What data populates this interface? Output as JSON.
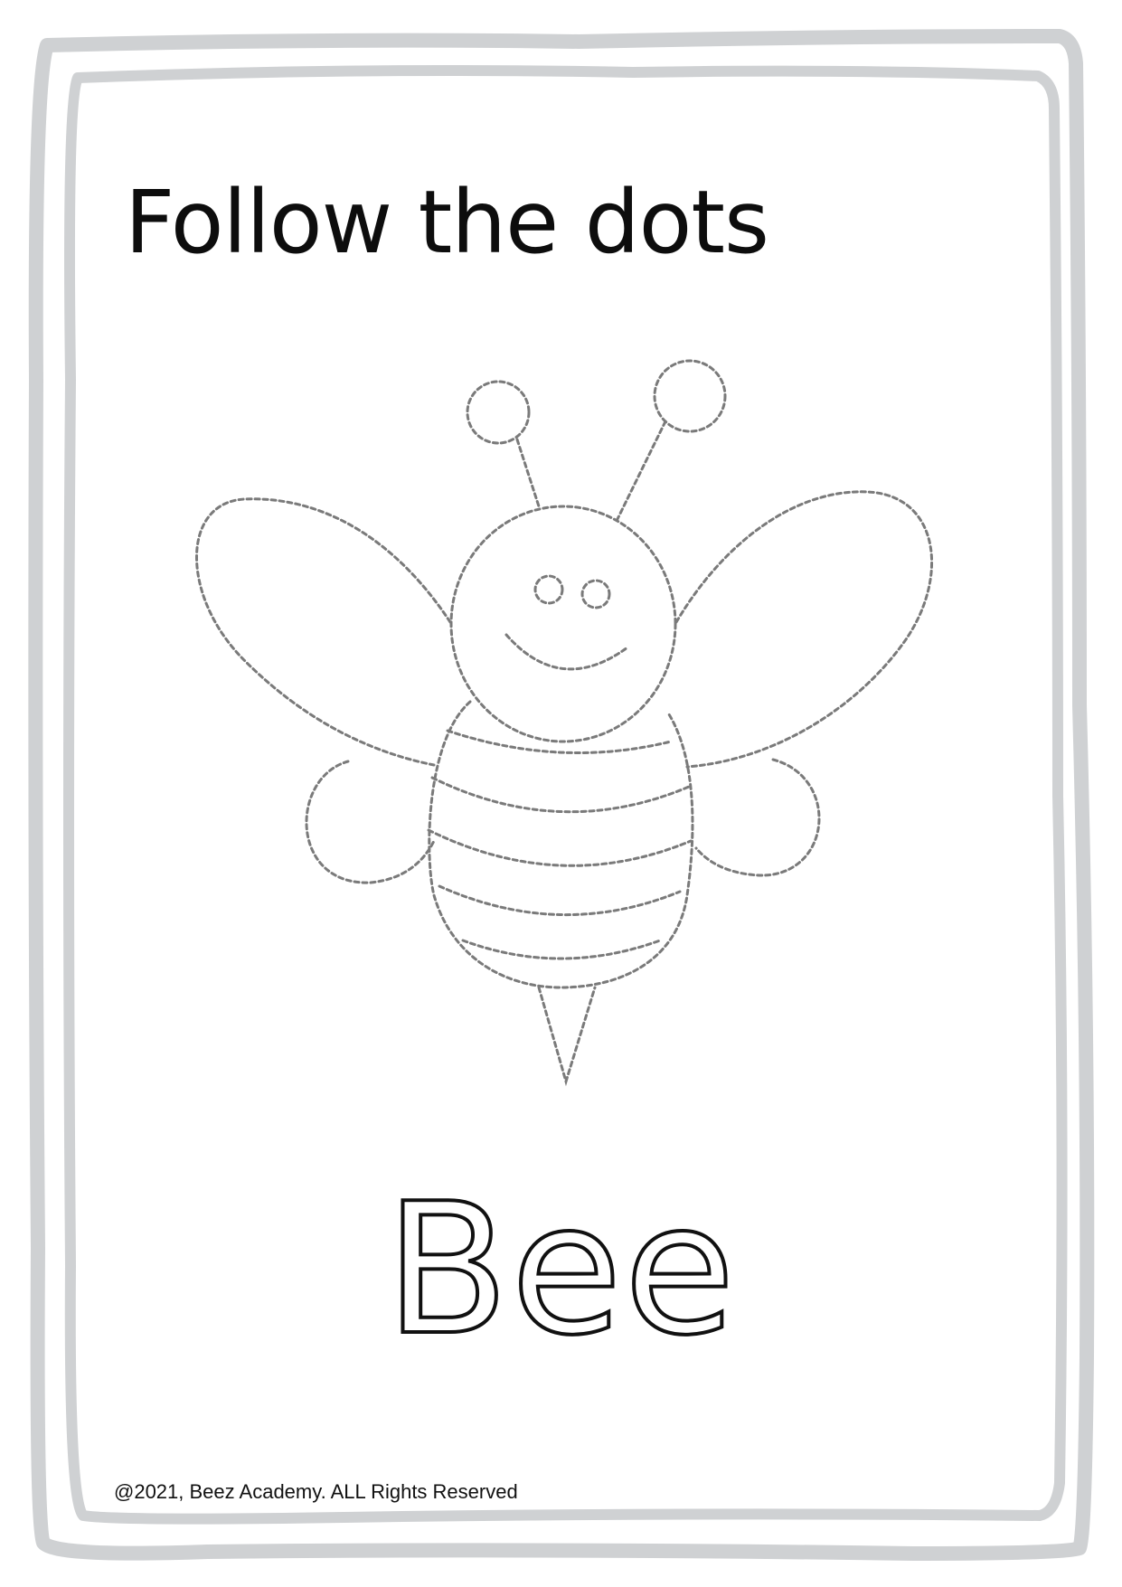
{
  "worksheet": {
    "title": "Follow the dots",
    "word": "Bee",
    "copyright": "@2021, Beez Academy. ALL Rights Reserved"
  },
  "illustration": {
    "subject": "bee",
    "style": "dotted-trace-outline"
  },
  "colors": {
    "frame": "#cfd1d3",
    "dots": "#7a7a7a",
    "text": "#0d0d0d",
    "background": "#ffffff"
  }
}
